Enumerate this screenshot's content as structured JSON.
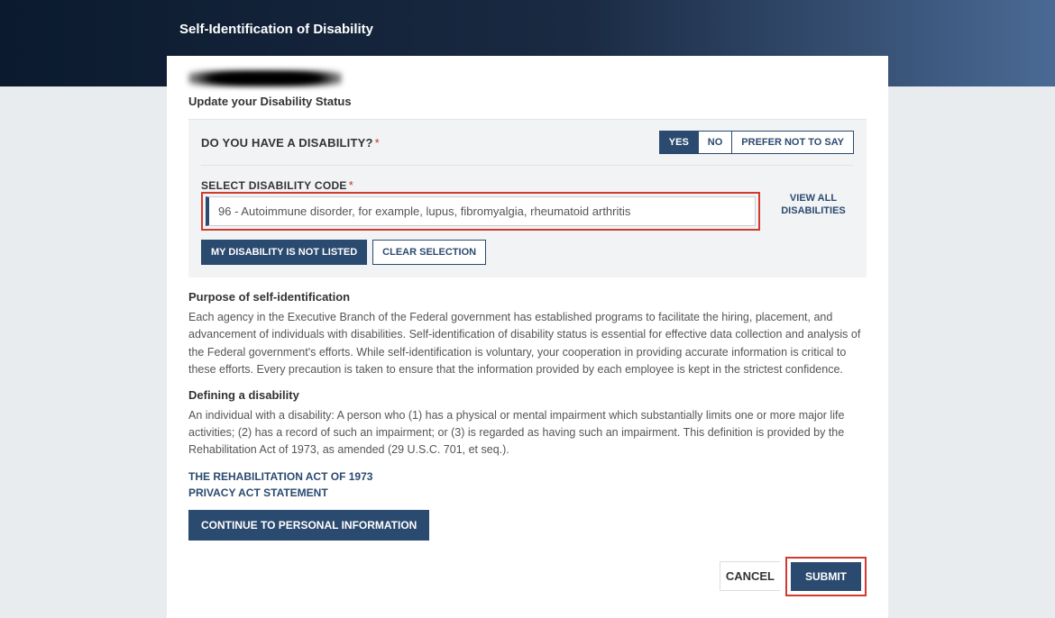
{
  "header": {
    "title": "Self-Identification of Disability"
  },
  "subtitle": "Update your Disability Status",
  "question": {
    "label": "DO YOU HAVE A DISABILITY?",
    "options": {
      "yes": "YES",
      "no": "NO",
      "prefer": "PREFER NOT TO SAY"
    },
    "selected": "yes"
  },
  "code": {
    "label": "SELECT DISABILITY CODE",
    "value": "96 - Autoimmune disorder, for example, lupus, fibromyalgia, rheumatoid arthritis",
    "view_all": "VIEW ALL DISABILITIES",
    "not_listed": "MY DISABILITY IS NOT LISTED",
    "clear": "CLEAR SELECTION"
  },
  "purpose": {
    "heading": "Purpose of self-identification",
    "text": "Each agency in the Executive Branch of the Federal government has established programs to facilitate the hiring, placement, and advancement of individuals with disabilities. Self-identification of disability status is essential for effective data collection and analysis of the Federal government's efforts. While self-identification is voluntary, your cooperation in providing accurate information is critical to these efforts. Every precaution is taken to ensure that the information provided by each employee is kept in the strictest confidence."
  },
  "definition": {
    "heading": "Defining a disability",
    "text": "An individual with a disability: A person who (1) has a physical or mental impairment which substantially limits one or more major life activities; (2) has a record of such an impairment; or (3) is regarded as having such an impairment. This definition is provided by the Rehabilitation Act of 1973, as amended (29 U.S.C. 701, et seq.)."
  },
  "links": {
    "rehab": "THE REHABILITATION ACT OF 1973",
    "privacy": "PRIVACY ACT STATEMENT"
  },
  "actions": {
    "continue": "CONTINUE TO PERSONAL INFORMATION",
    "cancel": "CANCEL",
    "submit": "SUBMIT"
  }
}
